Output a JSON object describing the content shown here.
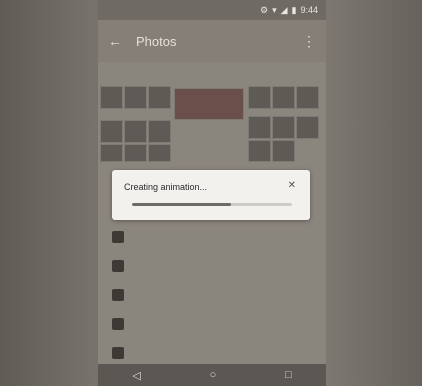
{
  "status_bar": {
    "icons": [
      "settings-icon",
      "wifi-icon",
      "signal-icon",
      "battery-icon"
    ],
    "time": "9:44"
  },
  "app_bar": {
    "title": "Photos"
  },
  "dialog": {
    "message": "Creating animation...",
    "progress": 0.62
  },
  "navigation": {
    "back_icon": "◁",
    "home_icon": "○",
    "recents_icon": "□"
  }
}
